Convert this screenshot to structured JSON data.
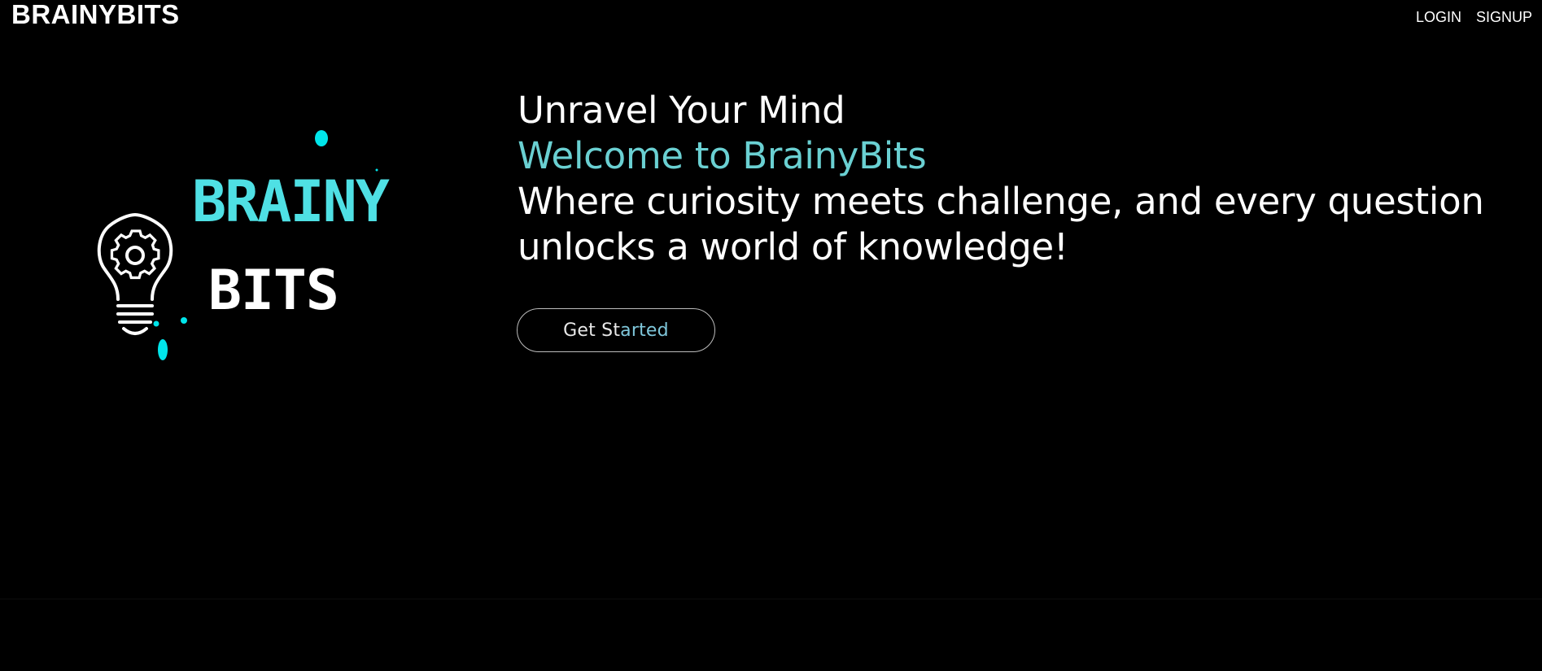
{
  "header": {
    "brand": "BRAINYBITS",
    "nav": [
      {
        "label": "LOGIN"
      },
      {
        "label": "SIGNUP"
      }
    ]
  },
  "hero": {
    "logo": {
      "word_top": "BRAINY",
      "word_bottom": "BITS"
    },
    "heading": "Unravel Your Mind",
    "welcome": "Welcome to BrainyBits",
    "tagline_line1": "Where curiosity meets challenge, and every question",
    "tagline_line2": "unlocks a world of knowledge!",
    "cta": {
      "part1": "Get St",
      "part2": "arted"
    }
  },
  "colors": {
    "background": "#000000",
    "accent": "#6ad0d2",
    "logo_cyan": "#00e5ea",
    "text": "#ffffff"
  },
  "icons": {
    "logo": "lightbulb-gear-icon"
  }
}
